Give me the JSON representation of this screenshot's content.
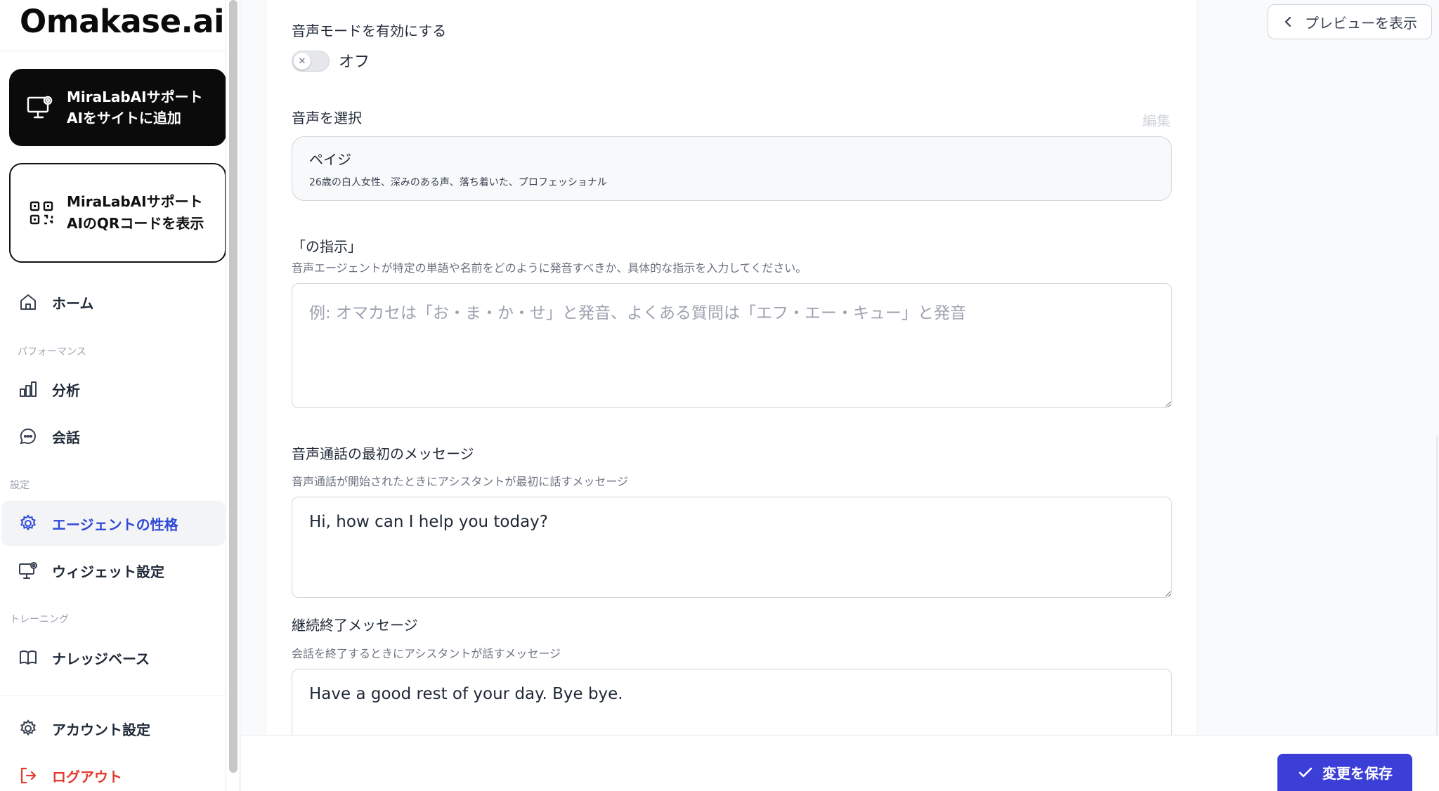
{
  "sidebar": {
    "logo": "Omakase.ai",
    "cta_add": "MiraLabAIサポートAIをサイトに追加",
    "cta_qr": "MiraLabAIサポートAIのQRコードを表示",
    "nav": {
      "home": "ホーム",
      "section_performance": "パフォーマンス",
      "analytics": "分析",
      "conversations": "会話",
      "section_settings": "設定",
      "agent_personality": "エージェントの性格",
      "widget_settings": "ウィジェット設定",
      "section_training": "トレーニング",
      "knowledge_base": "ナレッジベース",
      "account_settings": "アカウント設定",
      "logout": "ログアウト"
    }
  },
  "main": {
    "preview_button": "プレビューを表示",
    "voice_mode": {
      "label": "音声モードを有効にする",
      "state": "オフ"
    },
    "voice_select": {
      "label": "音声を選択",
      "edit": "編集",
      "name": "ペイジ",
      "description": "26歳の白人女性、深みのある声、落ち着いた、プロフェッショナル"
    },
    "pronunciation": {
      "label": "「の指示」",
      "helper": "音声エージェントが特定の単語や名前をどのように発音すべきか、具体的な指示を入力してください。",
      "placeholder": "例: オマカセは「お・ま・か・せ」と発音、よくある質問は「エフ・エー・キュー」と発音"
    },
    "first_message": {
      "label": "音声通話の最初のメッセージ",
      "helper": "音声通話が開始されたときにアシスタントが最初に話すメッセージ",
      "value": "Hi, how can I help you today?"
    },
    "end_message": {
      "label": "継続終了メッセージ",
      "helper": "会話を終了するときにアシスタントが話すメッセージ",
      "value": "Have a good rest of your day. Bye bye."
    },
    "save_button": "変更を保存"
  },
  "colors": {
    "accent": "#3b3fd8",
    "active_nav": "#2f49d8",
    "danger": "#e23b2e"
  }
}
